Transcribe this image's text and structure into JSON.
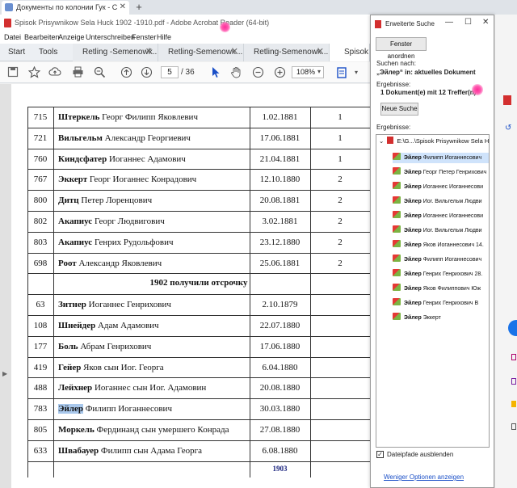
{
  "browser_tabs": [
    {
      "label": "Документы по колонии Гук - С",
      "close": "✕"
    }
  ],
  "new_tab_symbol": "+",
  "reader": {
    "title": "Spisok Prisywnikow Sela Huck 1902 -1910.pdf - Adobe Acrobat Reader (64-bit)",
    "menu": [
      "Datei",
      "Bearbeiten",
      "Anzeige",
      "Unterschreiben",
      "Fenster",
      "Hilfe"
    ],
    "tool_tabs": [
      "Start",
      "Tools"
    ],
    "doc_tabs": [
      "Retling -Semenowk...",
      "Retling-Semenowk...",
      "Retling-Semenowk...",
      "Spisok P"
    ],
    "close_symbol": "✕",
    "page_current": "5",
    "page_total": "/ 36",
    "zoom": "108%"
  },
  "table": {
    "rows": [
      {
        "num": "715",
        "bold": "Штеркель",
        "rest": " Георг Филипп Яковлевич",
        "date": "1.02.1881",
        "cat": "1"
      },
      {
        "num": "721",
        "bold": "Вильгельм",
        "rest": " Александр Георгиевич",
        "date": "17.06.1881",
        "cat": "1"
      },
      {
        "num": "760",
        "bold": "Киндсфатер",
        "rest": "  Иоганнес Адамович",
        "date": "21.04.1881",
        "cat": "1"
      },
      {
        "num": "767",
        "bold": "Эккерт",
        "rest": "  Георг Иоганнес Конрадович",
        "date": "12.10.1880",
        "cat": "2"
      },
      {
        "num": "800",
        "bold": "Дитц",
        "rest": "  Петер Лоренцович",
        "date": "20.08.1881",
        "cat": "2"
      },
      {
        "num": "802",
        "bold": "Акапиус",
        "rest": " Георг Людвигович",
        "date": "3.02.1881",
        "cat": "2"
      },
      {
        "num": "803",
        "bold": "Акапиус",
        "rest": " Генрих Рудольфович",
        "date": "23.12.1880",
        "cat": "2"
      },
      {
        "num": "698",
        "bold": "Роот",
        "rest": " Александр Яковлевич",
        "date": "25.06.1881",
        "cat": "2"
      },
      {
        "section": "1902  получили отсрочку"
      },
      {
        "num": "63",
        "bold": "Зитнер",
        "rest": "  Иоганнес Генрихович",
        "date": "2.10.1879",
        "cat": ""
      },
      {
        "num": "108",
        "bold": "Шнейдер",
        "rest": " Адам Адамович",
        "date": "22.07.1880",
        "cat": ""
      },
      {
        "num": "177",
        "bold": "Боль",
        "rest": "  Абрам Генрихович",
        "date": "17.06.1880",
        "cat": ""
      },
      {
        "num": "419",
        "bold": "Гейер",
        "rest": "  Яков сын Иог. Георга",
        "date": "6.04.1880",
        "cat": ""
      },
      {
        "num": "488",
        "bold": "Лейхнер",
        "rest": "  Иоганнес сын Иог. Адамовин",
        "date": "20.08.1880",
        "cat": ""
      },
      {
        "num": "783",
        "bold": "Эйлер",
        "rest": "  Филипп Иоганнесович",
        "date": "30.03.1880",
        "cat": ""
      },
      {
        "num": "805",
        "bold": "Моркель",
        "rest": " Фердинанд сын умершего Конрада",
        "date": "27.08.1880",
        "cat": ""
      },
      {
        "num": "633",
        "bold": "Швабауер",
        "rest": "  Филипп сын Адама Георга",
        "date": "6.08.1880",
        "cat": ""
      }
    ],
    "footer_partial": "1903"
  },
  "search": {
    "title": "Erweiterte Suche",
    "arrange_button": "Fenster anordnen",
    "searched_for_label": "Suchen nach:",
    "query": "„Эйлер“ in: aktuelles Dokument",
    "results_label_1": "Ergebnisse:",
    "results_summary": "1 Dokument(e) mit 12 Treffer(n)",
    "new_search_button": "Neue Suche",
    "results_label_2": "Ergebnisse:",
    "tree_root": "E:\\G...\\Spisok Prisywnikow Sela Huck",
    "results": [
      {
        "bold": "Эйлер",
        "rest": " Филипп Иоганнесович"
      },
      {
        "bold": "Эйлер",
        "rest": " Георг Петер Генрихович"
      },
      {
        "bold": "Эйлер",
        "rest": " Иоганнес Иоганнесови"
      },
      {
        "bold": "Эйлер",
        "rest": " Иог. Вильгельм Людви"
      },
      {
        "bold": "Эйлер",
        "rest": " Иоганнес Иоганнесови"
      },
      {
        "bold": "Эйлер",
        "rest": " Иог. Вильгельм Людви"
      },
      {
        "bold": "Эйлер",
        "rest": " Яков Иоганнесович 14."
      },
      {
        "bold": "Эйлер",
        "rest": " Филипп Иоганнесович"
      },
      {
        "bold": "Эйлер",
        "rest": " Генрих Генрихович 28."
      },
      {
        "bold": "Эйлер",
        "rest": " Яков Филиппович Юж"
      },
      {
        "bold": "Эйлер",
        "rest": " Генрих Генрихович В"
      },
      {
        "bold": "Эйлер",
        "rest": " Эккерт"
      }
    ],
    "hide_paths_checked": "✓",
    "hide_paths_label": "Dateipfade ausblenden",
    "more_options": "Weniger Optionen anzeigen"
  },
  "colors": {
    "accent": "#1a4fc7",
    "highlight": "#a9c8ec",
    "pdf_red": "#d32f2f"
  }
}
